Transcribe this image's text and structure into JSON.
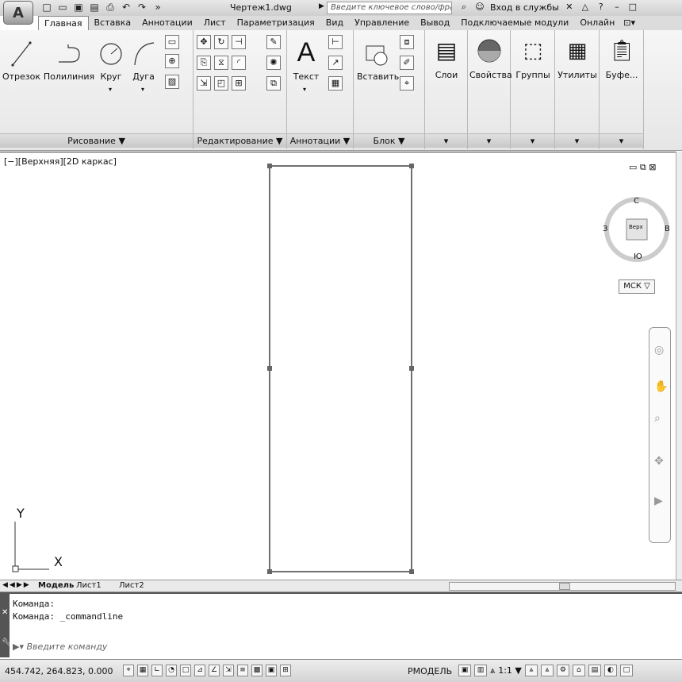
{
  "app": {
    "logo_letter": "A",
    "document_title": "Чертеж1.dwg"
  },
  "search": {
    "placeholder": "Введите ключевое слово/фразу"
  },
  "account": {
    "signin_label": "Вход в службы"
  },
  "ribbon_tabs": [
    "Главная",
    "Вставка",
    "Аннотации",
    "Лист",
    "Параметризация",
    "Вид",
    "Управление",
    "Вывод",
    "Подключаемые модули",
    "Онлайн"
  ],
  "active_tab": "Главная",
  "draw_panel": {
    "title": "Рисование ▼",
    "line": "Отрезок",
    "polyline": "Полилиния",
    "circle": "Круг",
    "arc": "Дуга"
  },
  "modify_panel": {
    "title": "Редактирование ▼"
  },
  "annotation_panel": {
    "title": "Аннотации ▼",
    "text": "Текст"
  },
  "block_panel": {
    "title": "Блок ▼",
    "insert": "Вставить"
  },
  "other_panels": {
    "layers": "Слои",
    "properties": "Свойства",
    "groups": "Группы",
    "utilities": "Утилиты",
    "clipboard": "Буфе..."
  },
  "viewport": {
    "label": "[−][Верхняя][2D каркас]",
    "ucs_y": "Y",
    "ucs_x": "X",
    "ucs_menu": "МСК ▽",
    "viewcube_face": "Верх",
    "viewcube_n": "С",
    "viewcube_s": "Ю",
    "viewcube_w": "З",
    "viewcube_e": "В"
  },
  "layout_tabs": {
    "model": "Модель",
    "sheet1": "Лист1",
    "sheet2": "Лист2"
  },
  "command_line": {
    "history": [
      "Команда:",
      "Команда: _commandline"
    ],
    "prompt_placeholder": "Введите команду"
  },
  "status_bar": {
    "coordinates": "454.742, 264.823, 0.000",
    "model_label": "РМОДЕЛЬ",
    "scale": "1:1 ▼"
  }
}
